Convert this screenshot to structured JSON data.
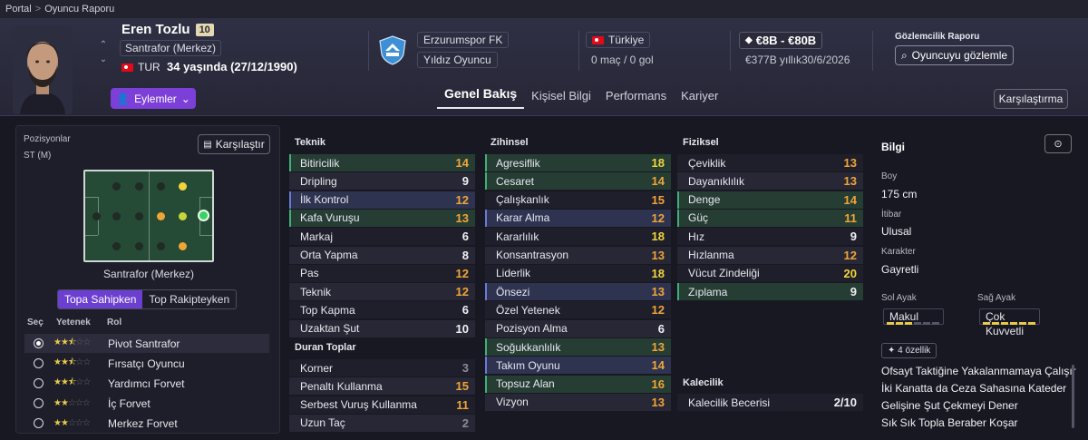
{
  "breadcrumb": {
    "portal": "Portal",
    "separator": ">",
    "current": "Oyuncu Raporu"
  },
  "player": {
    "name": "Eren Tozlu",
    "shirt_number": "10",
    "position": "Santrafor (Merkez)",
    "nationality_code": "TUR",
    "age_text": "34 yaşında (27/12/1990)",
    "actions_label": "Eylemler"
  },
  "club": {
    "name": "Erzurumspor FK",
    "status": "Yıldız Oyuncu"
  },
  "nation": {
    "name": "Türkiye",
    "caps": "0 maç / 0 gol"
  },
  "contract": {
    "value": "€8B - €80B",
    "wage": "€377B yıllık",
    "expiry": "30/6/2026"
  },
  "scouting": {
    "title": "Gözlemcilik Raporu",
    "button": "Oyuncuyu gözlemle"
  },
  "tabs": [
    {
      "label": "Genel Bakış",
      "active": true
    },
    {
      "label": "Kişisel Bilgi",
      "active": false
    },
    {
      "label": "Performans",
      "active": false
    },
    {
      "label": "Kariyer",
      "active": false
    }
  ],
  "compare_top": "Karşılaştırma",
  "positions": {
    "title": "Pozisyonlar",
    "value": "ST (M)",
    "compare_button": "Karşılaştır",
    "pitch_label": "Santrafor (Merkez)",
    "toggle": [
      "Topa Sahipken",
      "Top Rakipteyken"
    ],
    "role_headers": {
      "select": "Seç",
      "skill": "Yetenek",
      "role": "Rol"
    },
    "roles": [
      {
        "name": "Pivot Santrafor",
        "stars": 2.5,
        "selected": true
      },
      {
        "name": "Fırsatçı Oyuncu",
        "stars": 2.5,
        "selected": false
      },
      {
        "name": "Yardımcı Forvet",
        "stars": 2.5,
        "selected": false
      },
      {
        "name": "İç Forvet",
        "stars": 2,
        "selected": false
      },
      {
        "name": "Merkez Forvet",
        "stars": 2,
        "selected": false
      }
    ]
  },
  "colors": {
    "accent": "#7c3fd8",
    "high": "#f2d43a",
    "mid": "#f0a537",
    "low": "#8c8c98",
    "white": "#f0f0f4"
  },
  "technical": {
    "title": "Teknik",
    "items": [
      {
        "name": "Bitiricilik",
        "value": 14,
        "hl": "g"
      },
      {
        "name": "Dripling",
        "value": 9,
        "hl": ""
      },
      {
        "name": "İlk Kontrol",
        "value": 12,
        "hl": "b"
      },
      {
        "name": "Kafa Vuruşu",
        "value": 13,
        "hl": "g"
      },
      {
        "name": "Markaj",
        "value": 6,
        "hl": ""
      },
      {
        "name": "Orta Yapma",
        "value": 8,
        "hl": ""
      },
      {
        "name": "Pas",
        "value": 12,
        "hl": ""
      },
      {
        "name": "Teknik",
        "value": 12,
        "hl": ""
      },
      {
        "name": "Top Kapma",
        "value": 6,
        "hl": ""
      },
      {
        "name": "Uzaktan Şut",
        "value": 10,
        "hl": ""
      }
    ]
  },
  "set_pieces": {
    "title": "Duran Toplar",
    "items": [
      {
        "name": "Korner",
        "value": 3,
        "hl": ""
      },
      {
        "name": "Penaltı Kullanma",
        "value": 15,
        "hl": ""
      },
      {
        "name": "Serbest Vuruş Kullanma",
        "value": 11,
        "hl": ""
      },
      {
        "name": "Uzun Taç",
        "value": 2,
        "hl": ""
      }
    ]
  },
  "mental": {
    "title": "Zihinsel",
    "items": [
      {
        "name": "Agresiflik",
        "value": 18,
        "hl": "g"
      },
      {
        "name": "Cesaret",
        "value": 14,
        "hl": "g"
      },
      {
        "name": "Çalışkanlık",
        "value": 15,
        "hl": ""
      },
      {
        "name": "Karar Alma",
        "value": 12,
        "hl": "b"
      },
      {
        "name": "Kararlılık",
        "value": 18,
        "hl": ""
      },
      {
        "name": "Konsantrasyon",
        "value": 13,
        "hl": ""
      },
      {
        "name": "Liderlik",
        "value": 18,
        "hl": ""
      },
      {
        "name": "Önsezi",
        "value": 13,
        "hl": "b"
      },
      {
        "name": "Özel Yetenek",
        "value": 12,
        "hl": ""
      },
      {
        "name": "Pozisyon Alma",
        "value": 6,
        "hl": ""
      },
      {
        "name": "Soğukkanlılık",
        "value": 13,
        "hl": "g"
      },
      {
        "name": "Takım Oyunu",
        "value": 14,
        "hl": "b"
      },
      {
        "name": "Topsuz Alan",
        "value": 16,
        "hl": "g"
      },
      {
        "name": "Vizyon",
        "value": 13,
        "hl": ""
      }
    ]
  },
  "physical": {
    "title": "Fiziksel",
    "items": [
      {
        "name": "Çeviklik",
        "value": 13,
        "hl": ""
      },
      {
        "name": "Dayanıklılık",
        "value": 13,
        "hl": ""
      },
      {
        "name": "Denge",
        "value": 14,
        "hl": "g"
      },
      {
        "name": "Güç",
        "value": 11,
        "hl": "g"
      },
      {
        "name": "Hız",
        "value": 9,
        "hl": ""
      },
      {
        "name": "Hızlanma",
        "value": 12,
        "hl": ""
      },
      {
        "name": "Vücut Zindeliği",
        "value": 20,
        "hl": ""
      },
      {
        "name": "Zıplama",
        "value": 9,
        "hl": "g"
      }
    ]
  },
  "goalkeeping": {
    "title": "Kalecilik",
    "items": [
      {
        "name": "Kalecilik Becerisi",
        "value": "2/10"
      }
    ]
  },
  "info": {
    "title": "Bilgi",
    "height_label": "Boy",
    "height": "175 cm",
    "reputation_label": "İtibar",
    "reputation": "Ulusal",
    "personality_label": "Karakter",
    "personality": "Gayretli",
    "left_foot_label": "Sol Ayak",
    "left_foot": "Makul",
    "left_foot_level": 0.5,
    "right_foot_label": "Sağ Ayak",
    "right_foot": "Çok Kuvvetli",
    "right_foot_level": 1.0,
    "traits_badge": "4 özellik",
    "traits": [
      "Ofsayt Taktiğine Yakalanmamaya Çalışır",
      "İki Kanatta da Ceza Sahasına Kateder",
      "Gelişine Şut Çekmeyi Dener",
      "Sık Sık Topla Beraber Koşar"
    ]
  }
}
